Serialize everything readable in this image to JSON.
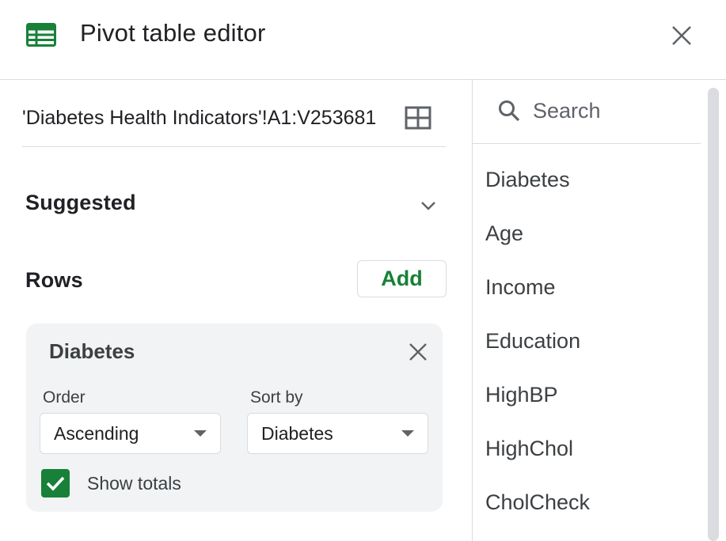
{
  "header": {
    "title": "Pivot table editor",
    "icon": "sheets-icon",
    "icon_color": "#188038"
  },
  "range": {
    "text": "'Diabetes Health Indicators'!A1:V253681"
  },
  "suggested": {
    "label": "Suggested"
  },
  "rows": {
    "label": "Rows",
    "add_label": "Add",
    "card": {
      "title": "Diabetes",
      "order_label": "Order",
      "order_value": "Ascending",
      "sortby_label": "Sort by",
      "sortby_value": "Diabetes",
      "show_totals_label": "Show totals",
      "show_totals_checked": true
    }
  },
  "field_panel": {
    "search_placeholder": "Search",
    "fields": [
      "Diabetes",
      "Age",
      "Income",
      "Education",
      "HighBP",
      "HighChol",
      "CholCheck"
    ]
  },
  "colors": {
    "accent": "#188038",
    "card_bg": "#f1f3f4",
    "divider": "#dadce0"
  }
}
